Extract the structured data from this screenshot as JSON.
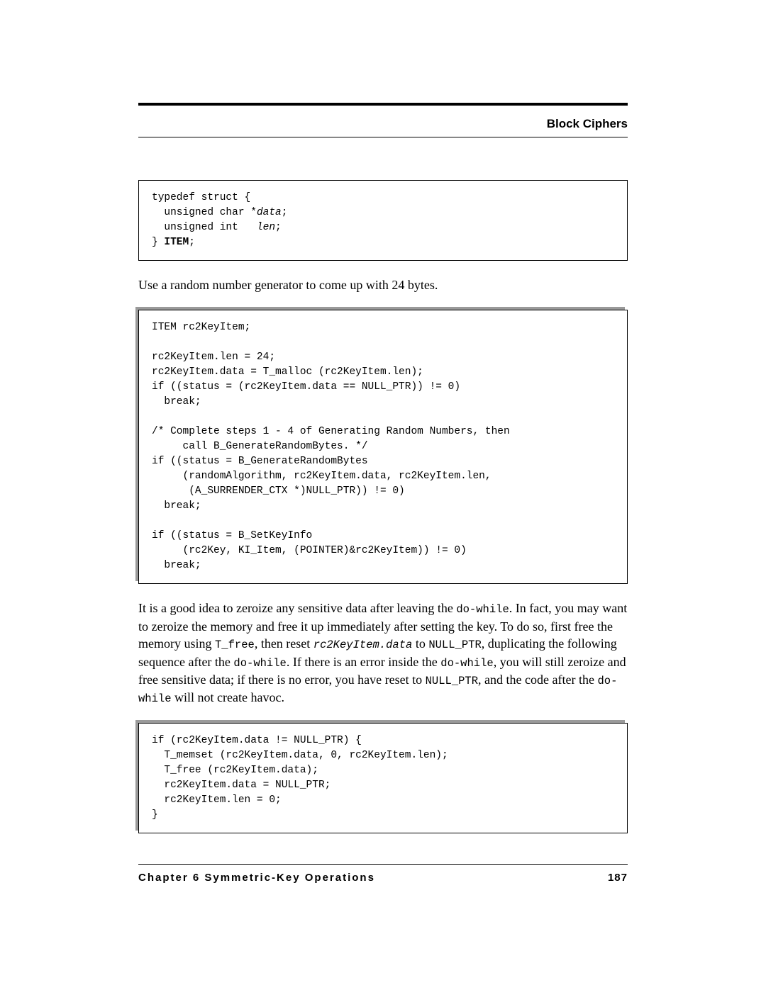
{
  "header": {
    "section_title": "Block Ciphers"
  },
  "code_block_1": {
    "line1": "typedef struct {",
    "line2_a": "  unsigned char *",
    "line2_b": "data",
    "line2_c": ";",
    "line3_a": "  unsigned int   ",
    "line3_b": "len",
    "line3_c": ";",
    "line4_a": "} ",
    "line4_b": "ITEM",
    "line4_c": ";"
  },
  "para1": "Use a random number generator to come up with 24 bytes.",
  "code_block_2": "ITEM rc2KeyItem;\n\nrc2KeyItem.len = 24;\nrc2KeyItem.data = T_malloc (rc2KeyItem.len);\nif ((status = (rc2KeyItem.data == NULL_PTR)) != 0)\n  break;\n\n/* Complete steps 1 - 4 of Generating Random Numbers, then\n     call B_GenerateRandomBytes. */\nif ((status = B_GenerateRandomBytes\n     (randomAlgorithm, rc2KeyItem.data, rc2KeyItem.len,\n      (A_SURRENDER_CTX *)NULL_PTR)) != 0)\n  break;\n\nif ((status = B_SetKeyInfo\n     (rc2Key, KI_Item, (POINTER)&rc2KeyItem)) != 0)\n  break;",
  "para2": {
    "t1": "It is a good idea to zeroize any sensitive data after leaving the ",
    "c1": "do-while",
    "t2": ". In fact, you may want to zeroize the memory and free it up immediately after setting the key. To do so, first free the memory using ",
    "c2": "T_free",
    "t3": ", then reset ",
    "c3": "rc2KeyItem.data",
    "t4": " to ",
    "c4": "NULL_PTR",
    "t5": ", duplicating the following sequence after the ",
    "c5": "do-while",
    "t6": ". If there is an error inside the ",
    "c6": "do-while",
    "t7": ", you will still zeroize and free sensitive data; if there is no error, you have reset to ",
    "c7": "NULL_PTR",
    "t8": ", and the code after the ",
    "c8": "do-while",
    "t9": " will not create havoc."
  },
  "code_block_3": "if (rc2KeyItem.data != NULL_PTR) {\n  T_memset (rc2KeyItem.data, 0, rc2KeyItem.len);\n  T_free (rc2KeyItem.data);\n  rc2KeyItem.data = NULL_PTR;\n  rc2KeyItem.len = 0;\n}",
  "footer": {
    "chapter": "Chapter 6  Symmetric-Key Operations",
    "page": "187"
  }
}
